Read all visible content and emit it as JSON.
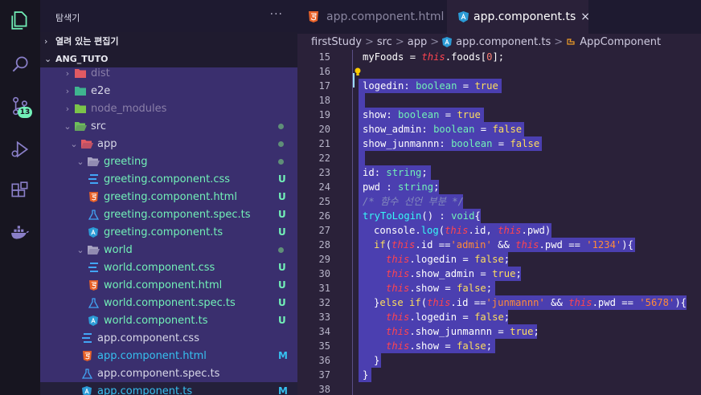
{
  "sidebar": {
    "title": "탐색기",
    "more": "···",
    "open_editors": "열려 있는 편집기",
    "project": "ANG_TUTO",
    "tree": [
      {
        "name": "dist",
        "status": "",
        "color": "#8a7fa8"
      },
      {
        "name": "e2e",
        "status": "",
        "color": "#d8d8e8"
      },
      {
        "name": "node_modules",
        "status": "",
        "color": "#8a7fa8"
      },
      {
        "name": "src",
        "status": "",
        "color": "#d8d8e8"
      },
      {
        "name": "app",
        "status": "",
        "color": "#d8d8e8"
      },
      {
        "name": "greeting",
        "status": "",
        "color": "#72f1b8"
      },
      {
        "name": "greeting.component.css",
        "status": "U",
        "color": "#72f1b8"
      },
      {
        "name": "greeting.component.html",
        "status": "U",
        "color": "#72f1b8"
      },
      {
        "name": "greeting.component.spec.ts",
        "status": "U",
        "color": "#72f1b8"
      },
      {
        "name": "greeting.component.ts",
        "status": "U",
        "color": "#72f1b8"
      },
      {
        "name": "world",
        "status": "",
        "color": "#72f1b8"
      },
      {
        "name": "world.component.css",
        "status": "U",
        "color": "#72f1b8"
      },
      {
        "name": "world.component.html",
        "status": "U",
        "color": "#72f1b8"
      },
      {
        "name": "world.component.spec.ts",
        "status": "U",
        "color": "#72f1b8"
      },
      {
        "name": "world.component.ts",
        "status": "U",
        "color": "#72f1b8"
      },
      {
        "name": "app.component.css",
        "status": "",
        "color": "#d8d8e8"
      },
      {
        "name": "app.component.html",
        "status": "M",
        "color": "#36c0f0"
      },
      {
        "name": "app.component.spec.ts",
        "status": "",
        "color": "#d8d8e8"
      },
      {
        "name": "app.component.ts",
        "status": "M",
        "color": "#36c0f0"
      }
    ]
  },
  "activity": {
    "scm_badge": "13"
  },
  "tabs": [
    {
      "label": "app.component.html"
    },
    {
      "label": "app.component.ts",
      "close": "×"
    }
  ],
  "breadcrumb": [
    "firstStudy",
    "src",
    "app",
    "app.component.ts",
    "AppComponent"
  ],
  "breadcrumb_sep": ">",
  "line_numbers": [
    "15",
    "16",
    "17",
    "18",
    "19",
    "20",
    "21",
    "22",
    "23",
    "24",
    "25",
    "26",
    "27",
    "28",
    "29",
    "30",
    "31",
    "32",
    "33",
    "34",
    "35",
    "36",
    "37",
    "38"
  ]
}
